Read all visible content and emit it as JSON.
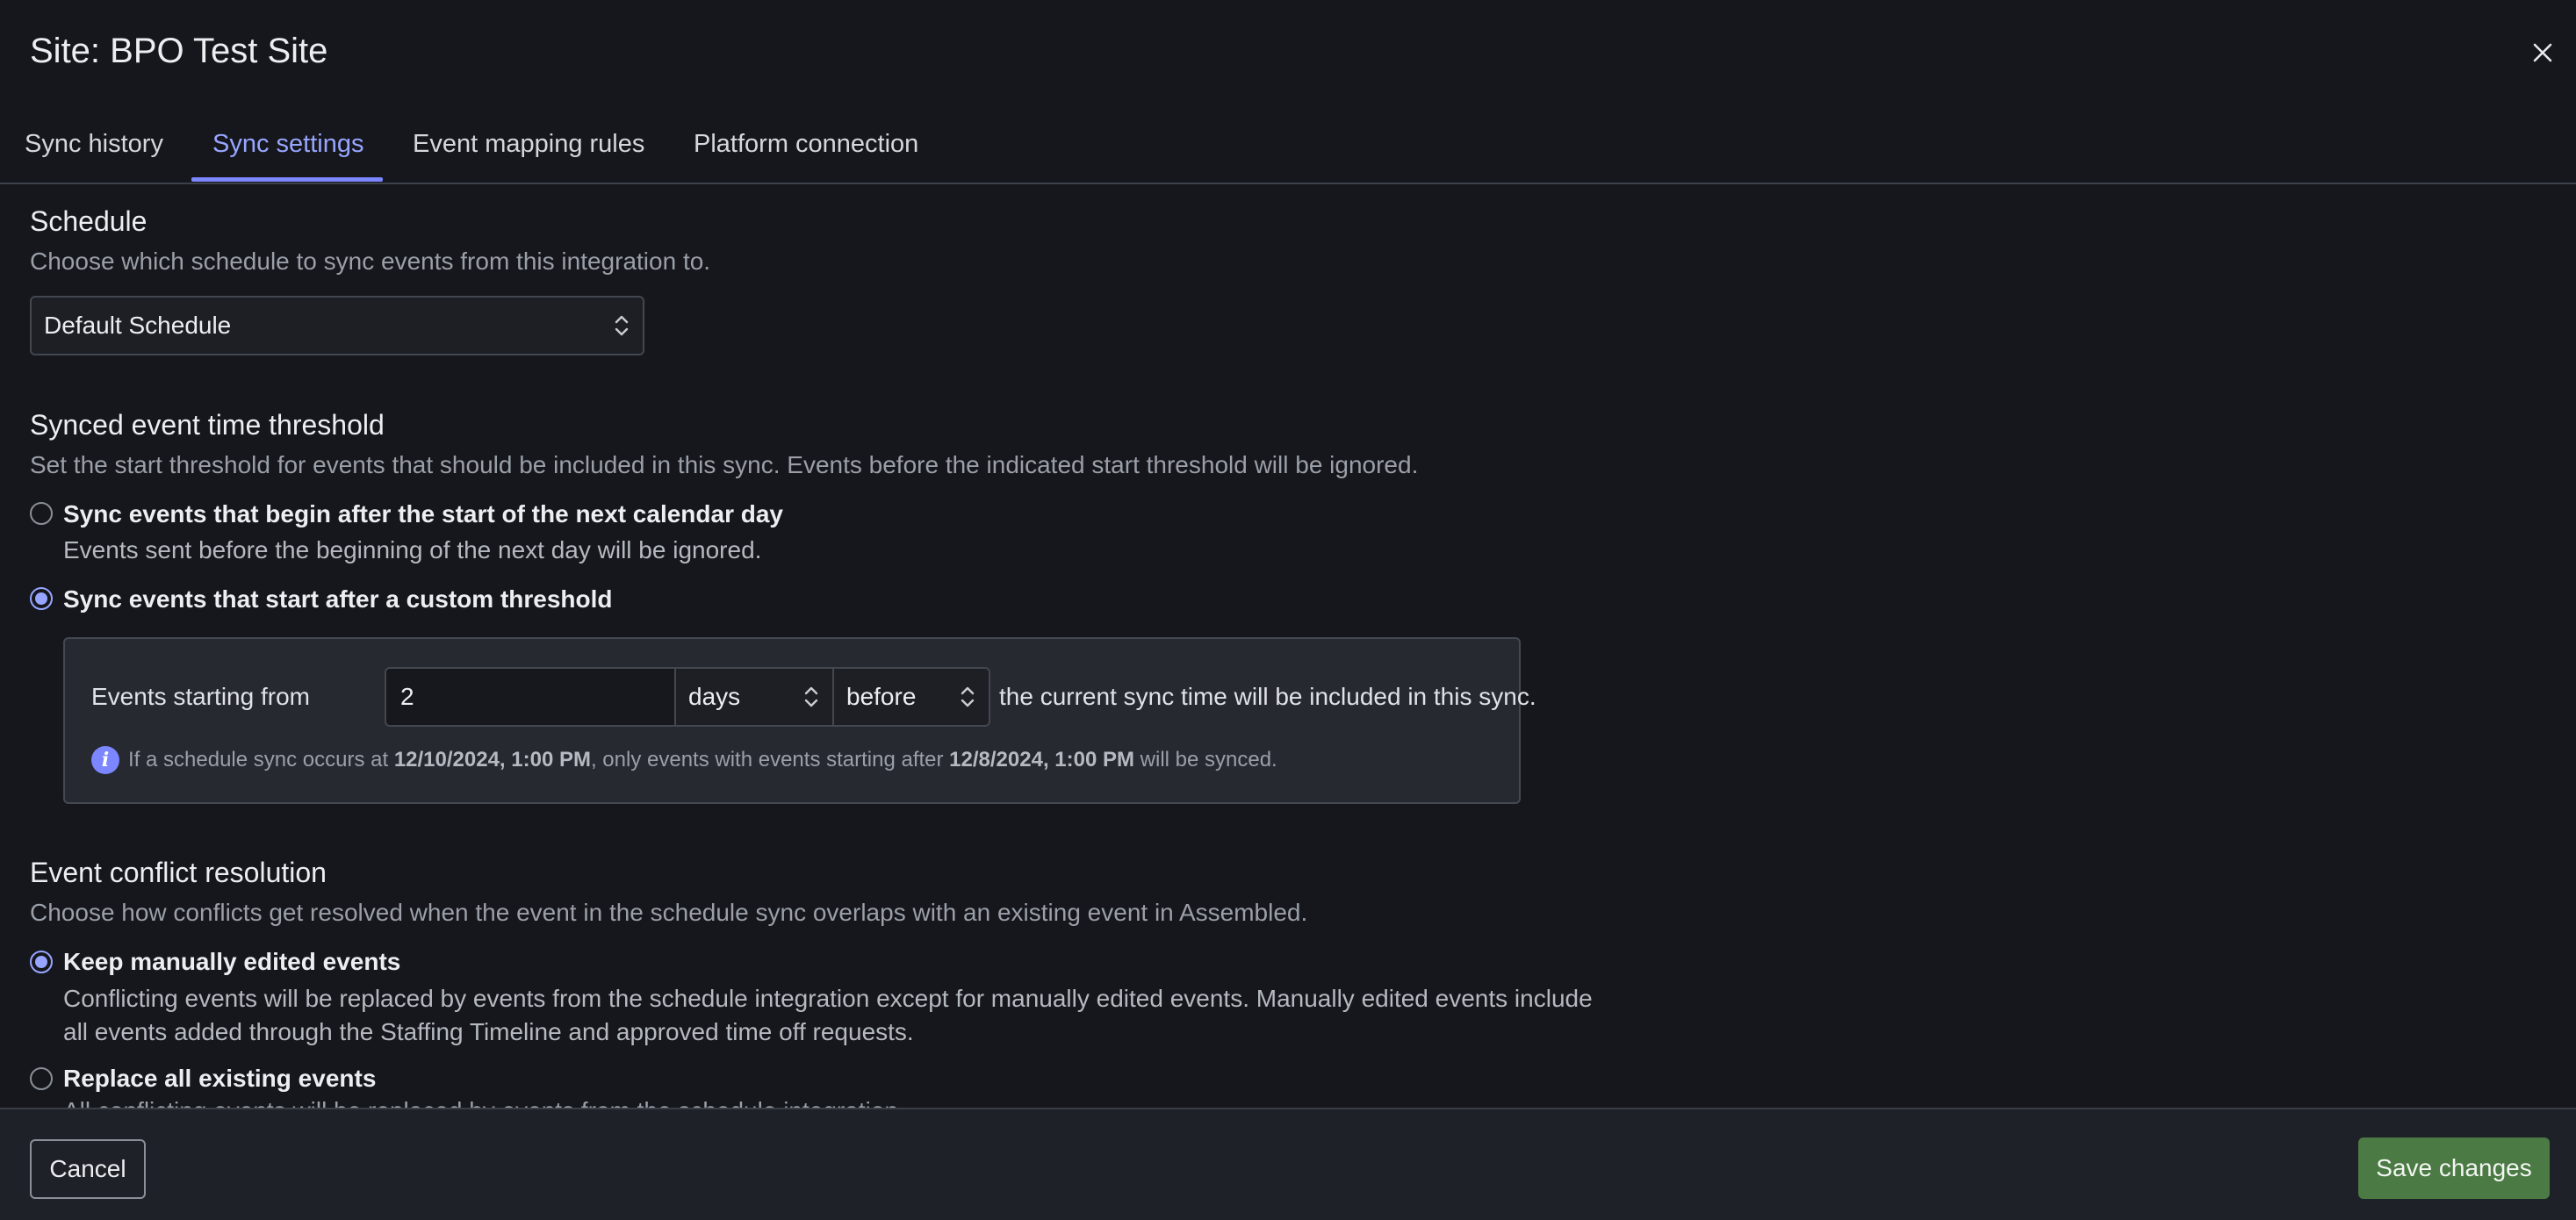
{
  "header": {
    "title": "Site: BPO Test Site",
    "close_icon": "close-icon"
  },
  "tabs": [
    {
      "label": "Sync history",
      "active": false
    },
    {
      "label": "Sync settings",
      "active": true
    },
    {
      "label": "Event mapping rules",
      "active": false
    },
    {
      "label": "Platform connection",
      "active": false
    }
  ],
  "accent_color": "#98a5ff",
  "schedule": {
    "title": "Schedule",
    "description": "Choose which schedule to sync events from this integration to.",
    "selected": "Default Schedule"
  },
  "threshold": {
    "title": "Synced event time threshold",
    "description": "Set the start threshold for events that should be included in this sync. Events before the indicated start threshold will be ignored.",
    "options": [
      {
        "label": "Sync events that begin after the start of the next calendar day",
        "desc": "Events sent before the beginning of the next day will be ignored.",
        "checked": false
      },
      {
        "label": "Sync events that start after a custom threshold",
        "checked": true
      }
    ],
    "custom": {
      "prefix": "Events starting from",
      "amount": "2",
      "unit": "days",
      "direction": "before",
      "suffix": "the current sync time will be included in this sync.",
      "info_part1": "If a schedule sync occurs at ",
      "info_date1": "12/10/2024, 1:00 PM",
      "info_part2": ", only events with events starting after ",
      "info_date2": "12/8/2024, 1:00 PM",
      "info_part3": " will be synced."
    }
  },
  "conflict": {
    "title": "Event conflict resolution",
    "description": "Choose how conflicts get resolved when the event in the schedule sync overlaps with an existing event in Assembled.",
    "options": [
      {
        "label": "Keep manually edited events",
        "desc_line1": "Conflicting events will be replaced by events from the schedule integration except for manually edited events. Manually edited events include",
        "desc_line2": "all events added through the Staffing Timeline and approved time off requests.",
        "checked": true
      },
      {
        "label": "Replace all existing events",
        "desc_line1": "All conflicting events will be replaced by events from the schedule integration.",
        "checked": false
      }
    ]
  },
  "footer": {
    "cancel_label": "Cancel",
    "save_label": "Save changes",
    "save_color": "#4b7a45"
  }
}
